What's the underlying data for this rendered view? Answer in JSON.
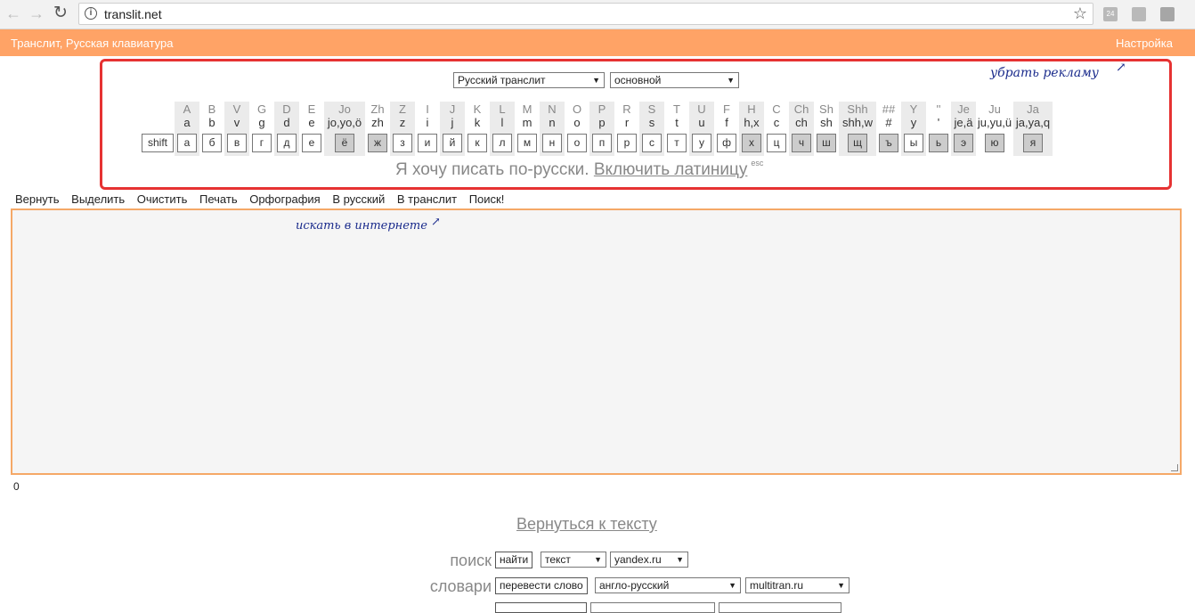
{
  "browser": {
    "back_icon": "←",
    "forward_icon": "→",
    "reload_icon": "↻",
    "url": "translit.net",
    "star_icon": "☆",
    "extensions": [
      "24",
      "rss",
      "pocket"
    ]
  },
  "topbar": {
    "title": "Транслит, Русская клавиатура",
    "settings": "Настройка"
  },
  "panel": {
    "layout_select": "Русский транслит",
    "mode_select": "основной",
    "annotation": "убрать рекламу",
    "keys": [
      {
        "cap": "",
        "low": "",
        "key": "shift",
        "dark": false,
        "shade": false
      },
      {
        "cap": "A",
        "low": "a",
        "key": "а",
        "dark": false,
        "shade": true
      },
      {
        "cap": "B",
        "low": "b",
        "key": "б",
        "dark": false,
        "shade": false
      },
      {
        "cap": "V",
        "low": "v",
        "key": "в",
        "dark": false,
        "shade": true
      },
      {
        "cap": "G",
        "low": "g",
        "key": "г",
        "dark": false,
        "shade": false
      },
      {
        "cap": "D",
        "low": "d",
        "key": "д",
        "dark": false,
        "shade": true
      },
      {
        "cap": "E",
        "low": "e",
        "key": "е",
        "dark": false,
        "shade": false
      },
      {
        "cap": "Jo",
        "low": "jo,yo,ö",
        "key": "ё",
        "dark": true,
        "shade": true
      },
      {
        "cap": "Zh",
        "low": "zh",
        "key": "ж",
        "dark": true,
        "shade": false
      },
      {
        "cap": "Z",
        "low": "z",
        "key": "з",
        "dark": false,
        "shade": true
      },
      {
        "cap": "I",
        "low": "i",
        "key": "и",
        "dark": false,
        "shade": false
      },
      {
        "cap": "J",
        "low": "j",
        "key": "й",
        "dark": false,
        "shade": true
      },
      {
        "cap": "K",
        "low": "k",
        "key": "к",
        "dark": false,
        "shade": false
      },
      {
        "cap": "L",
        "low": "l",
        "key": "л",
        "dark": false,
        "shade": true
      },
      {
        "cap": "M",
        "low": "m",
        "key": "м",
        "dark": false,
        "shade": false
      },
      {
        "cap": "N",
        "low": "n",
        "key": "н",
        "dark": false,
        "shade": true
      },
      {
        "cap": "O",
        "low": "o",
        "key": "о",
        "dark": false,
        "shade": false
      },
      {
        "cap": "P",
        "low": "p",
        "key": "п",
        "dark": false,
        "shade": true
      },
      {
        "cap": "R",
        "low": "r",
        "key": "р",
        "dark": false,
        "shade": false
      },
      {
        "cap": "S",
        "low": "s",
        "key": "с",
        "dark": false,
        "shade": true
      },
      {
        "cap": "T",
        "low": "t",
        "key": "т",
        "dark": false,
        "shade": false
      },
      {
        "cap": "U",
        "low": "u",
        "key": "у",
        "dark": false,
        "shade": true
      },
      {
        "cap": "F",
        "low": "f",
        "key": "ф",
        "dark": false,
        "shade": false
      },
      {
        "cap": "H",
        "low": "h,x",
        "key": "х",
        "dark": true,
        "shade": true
      },
      {
        "cap": "C",
        "low": "c",
        "key": "ц",
        "dark": false,
        "shade": false
      },
      {
        "cap": "Ch",
        "low": "ch",
        "key": "ч",
        "dark": true,
        "shade": true
      },
      {
        "cap": "Sh",
        "low": "sh",
        "key": "ш",
        "dark": true,
        "shade": false
      },
      {
        "cap": "Shh",
        "low": "shh,w",
        "key": "щ",
        "dark": true,
        "shade": true
      },
      {
        "cap": "##",
        "low": "#",
        "key": "ъ",
        "dark": true,
        "shade": false
      },
      {
        "cap": "Y",
        "low": "y",
        "key": "ы",
        "dark": false,
        "shade": true
      },
      {
        "cap": "''",
        "low": "'",
        "key": "ь",
        "dark": true,
        "shade": false
      },
      {
        "cap": "Je",
        "low": "je,ä",
        "key": "э",
        "dark": true,
        "shade": true
      },
      {
        "cap": "Ju",
        "low": "ju,yu,ü",
        "key": "ю",
        "dark": true,
        "shade": false
      },
      {
        "cap": "Ja",
        "low": "ja,ya,q",
        "key": "я",
        "dark": true,
        "shade": true
      }
    ],
    "status_text": "Я хочу писать по-русски.",
    "toggle_link": "Включить латиницу",
    "esc_hint": "esc"
  },
  "toolbar": [
    "Вернуть",
    "Выделить",
    "Очистить",
    "Печать",
    "Орфография",
    "В русский",
    "В транслит",
    "Поиск!"
  ],
  "editor": {
    "annotation": "искать в интернете",
    "char_count": "0"
  },
  "back_link": "Вернуться к тексту",
  "search_row": {
    "label": "поиск",
    "button": "найти",
    "type_select": "текст",
    "engine_select": "yandex.ru"
  },
  "dict_row": {
    "label": "словари",
    "button": "перевести слово",
    "lang_select": "англо-русский",
    "site_select": "multitran.ru"
  }
}
